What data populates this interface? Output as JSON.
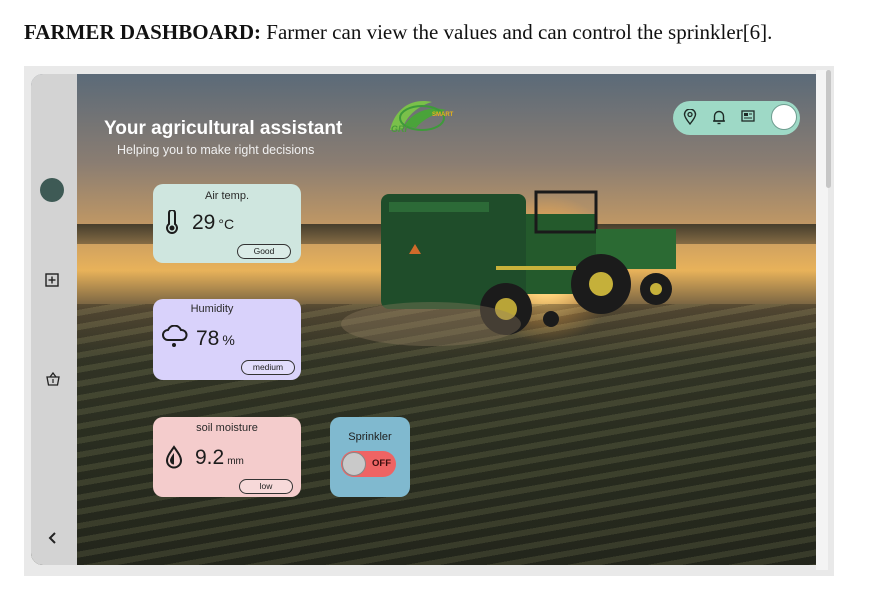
{
  "caption": {
    "bold": "FARMER DASHBOARD:",
    "text": " Farmer can view the values and can control the sprinkler[6]."
  },
  "hero": {
    "title": "Your agricultural assistant",
    "subtitle": "Helping you to make right decisions"
  },
  "logo": {
    "text": "GRI",
    "smart": "SMART"
  },
  "topbar": {
    "icons": [
      "location-pin-icon",
      "bell-icon",
      "news-icon"
    ],
    "toggle": "profile-toggle"
  },
  "sidebar": {
    "icons": [
      "avatar",
      "plus-square-icon",
      "basket-icon",
      "chevron-left-icon"
    ]
  },
  "cards": {
    "air": {
      "title": "Air temp.",
      "value": "29",
      "unit": "°C",
      "status": "Good",
      "icon": "thermometer-icon"
    },
    "humidity": {
      "title": "Humidity",
      "value": "78",
      "unit": "%",
      "status": "medium",
      "icon": "cloud-rain-icon"
    },
    "soil": {
      "title": "soil moisture",
      "value": "9.2",
      "unit": "mm",
      "status": "low",
      "icon": "drop-icon"
    }
  },
  "sprinkler": {
    "title": "Sprinkler",
    "state": "OFF",
    "on": false
  },
  "colors": {
    "air_card": "#cfe6df",
    "humidity_card": "#d9d2fb",
    "soil_card": "#f4cccc",
    "sprinkler_card": "#80b9cf",
    "toggle_off": "#ee6464",
    "topbar": "#9ed9c6"
  }
}
